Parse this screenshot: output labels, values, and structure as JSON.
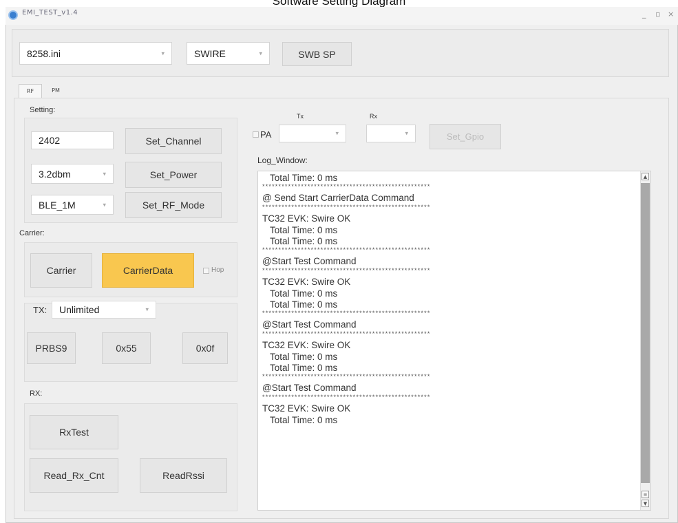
{
  "caption": "Software Setting Diagram",
  "window": {
    "title": "EMI_TEST_v1.4",
    "min": "_",
    "max": "▫",
    "close": "×"
  },
  "top": {
    "ini_file": "8258.ini",
    "interface": "SWIRE",
    "swb_button": "SWB SP"
  },
  "tabs": [
    "RF",
    "PM"
  ],
  "setting": {
    "group_label": "Setting:",
    "channel_value": "2402",
    "set_channel": "Set_Channel",
    "power_value": "3.2dbm",
    "set_power": "Set_Power",
    "mode_value": "BLE_1M",
    "set_rf_mode": "Set_RF_Mode"
  },
  "carrier": {
    "group_label": "Carrier:",
    "carrier_btn": "Carrier",
    "carrierdata_btn": "CarrierData",
    "hop": "Hop"
  },
  "tx": {
    "label": "TX:",
    "mode_value": "Unlimited",
    "prbs9": "PRBS9",
    "x55": "0x55",
    "x0f": "0x0f"
  },
  "rx": {
    "group_label": "RX:",
    "rxtest": "RxTest",
    "read_rx_cnt": "Read_Rx_Cnt",
    "read_rssi": "ReadRssi"
  },
  "gpio": {
    "pa_label": "PA",
    "tx_label": "Tx",
    "rx_label": "Rx",
    "set_gpio": "Set_Gpio"
  },
  "log": {
    "label": "Log_Window:",
    "lines": [
      {
        "type": "text",
        "text": "   Total Time: 0 ms"
      },
      {
        "type": "stars",
        "text": "****************************************************"
      },
      {
        "type": "cmd",
        "text": "@ Send Start CarrierData Command"
      },
      {
        "type": "stars",
        "text": "****************************************************"
      },
      {
        "type": "cmd",
        "text": "TC32 EVK: Swire OK"
      },
      {
        "type": "text",
        "text": "   Total Time: 0 ms"
      },
      {
        "type": "text",
        "text": "   Total Time: 0 ms"
      },
      {
        "type": "stars",
        "text": "****************************************************"
      },
      {
        "type": "cmd",
        "text": "@Start Test Command"
      },
      {
        "type": "stars",
        "text": "****************************************************"
      },
      {
        "type": "cmd",
        "text": "TC32 EVK: Swire OK"
      },
      {
        "type": "text",
        "text": "   Total Time: 0 ms"
      },
      {
        "type": "text",
        "text": "   Total Time: 0 ms"
      },
      {
        "type": "stars",
        "text": "****************************************************"
      },
      {
        "type": "cmd",
        "text": "@Start Test Command"
      },
      {
        "type": "stars",
        "text": "****************************************************"
      },
      {
        "type": "cmd",
        "text": "TC32 EVK: Swire OK"
      },
      {
        "type": "text",
        "text": "   Total Time: 0 ms"
      },
      {
        "type": "text",
        "text": "   Total Time: 0 ms"
      },
      {
        "type": "stars",
        "text": "****************************************************"
      },
      {
        "type": "cmd",
        "text": "@Start Test Command"
      },
      {
        "type": "stars",
        "text": "****************************************************"
      },
      {
        "type": "cmd",
        "text": "TC32 EVK: Swire OK"
      },
      {
        "type": "text",
        "text": "   Total Time: 0 ms"
      }
    ]
  },
  "colors": {
    "highlight": "#f9c74f",
    "accent": "#3a7fd0"
  }
}
